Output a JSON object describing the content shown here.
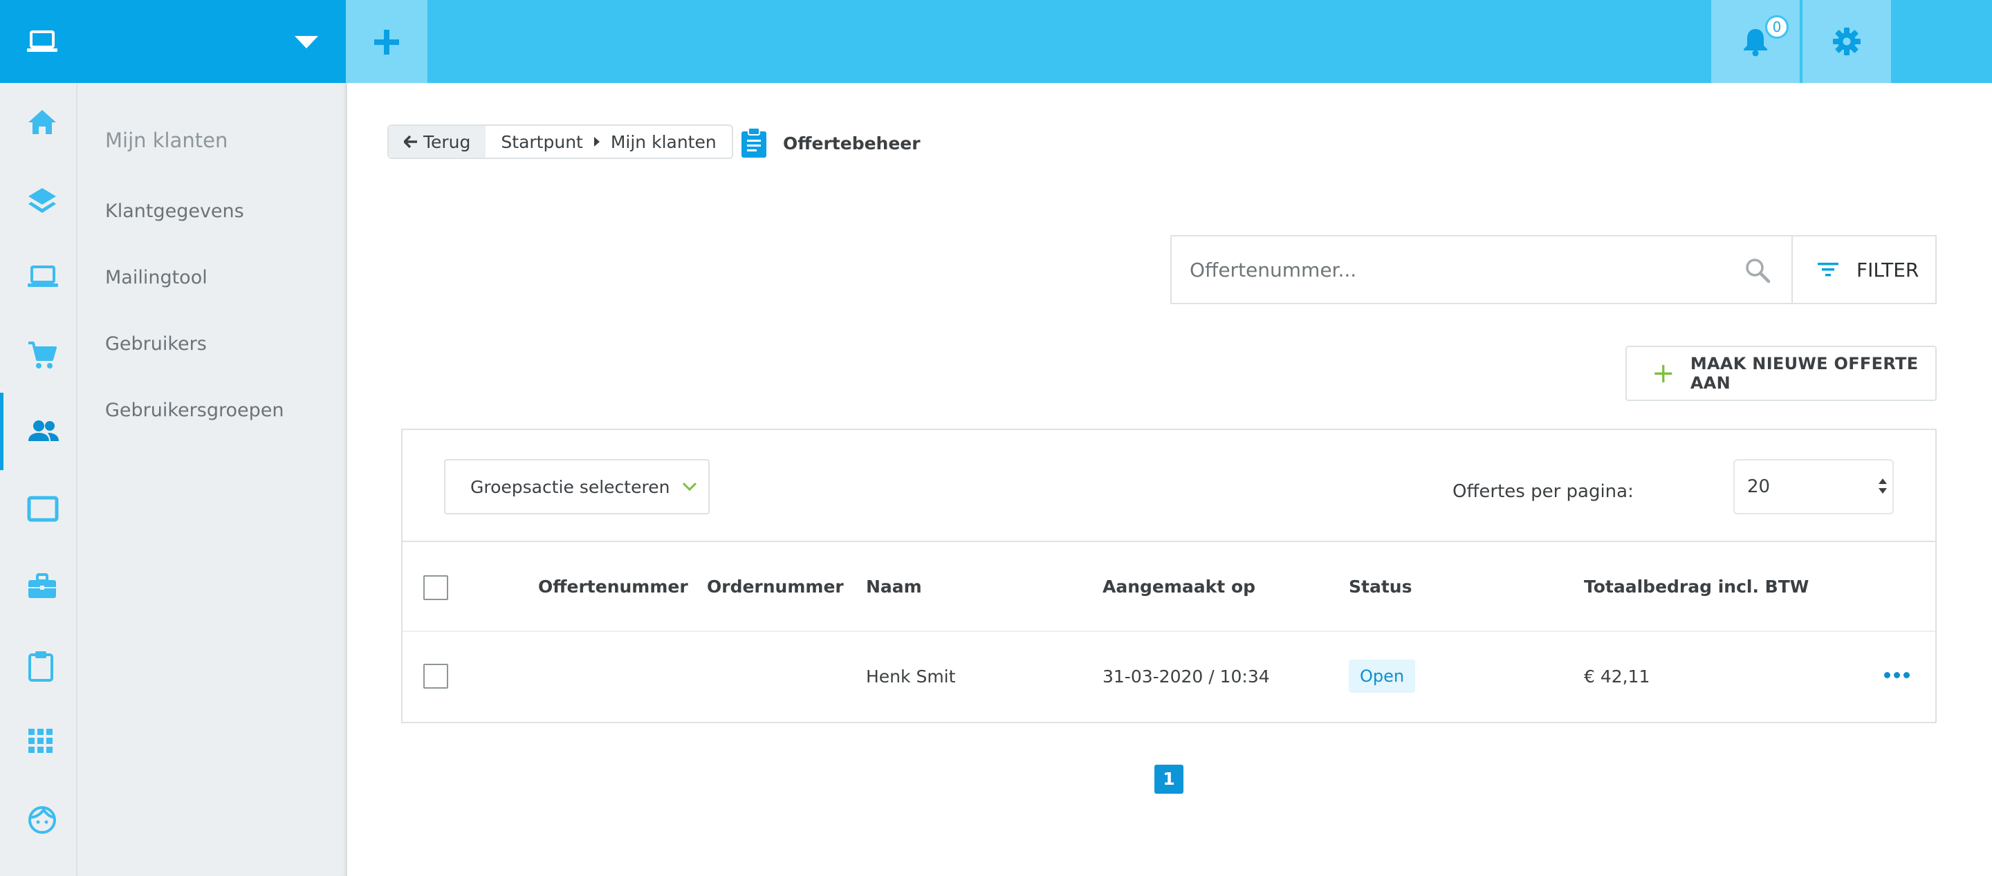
{
  "topbar": {
    "notification_count": "0",
    "colors": {
      "bar": "#3cc3f2",
      "device": "#05a5e8",
      "add": "#7dd8f7"
    }
  },
  "rail": {
    "icons": [
      "home-icon",
      "layers-icon",
      "laptop-icon",
      "cart-icon",
      "users-icon",
      "tablet-icon",
      "briefcase-icon",
      "clipboard-icon",
      "apps-grid-icon",
      "face-icon"
    ],
    "active_icon": "users-icon"
  },
  "subnav": {
    "heading": "Mijn klanten",
    "items": [
      {
        "label": "Klantgegevens"
      },
      {
        "label": "Mailingtool"
      },
      {
        "label": "Gebruikers"
      },
      {
        "label": "Gebruikersgroepen"
      }
    ]
  },
  "breadcrumb": {
    "back_label": "Terug",
    "crumbs": [
      "Startpunt",
      "Mijn klanten"
    ],
    "current": "Offertebeheer"
  },
  "search": {
    "placeholder": "Offertenummer...",
    "value": ""
  },
  "filter": {
    "label": "FILTER"
  },
  "new_quote": {
    "label": "MAAK NIEUWE OFFERTE AAN"
  },
  "table": {
    "bulk_action_placeholder": "Groepsactie selecteren",
    "per_page_label": "Offertes per pagina:",
    "per_page_value": "20",
    "columns": [
      "Offertenummer",
      "Ordernummer",
      "Naam",
      "Aangemaakt op",
      "Status",
      "Totaalbedrag incl. BTW"
    ],
    "rows": [
      {
        "offertenummer": "",
        "ordernummer": "",
        "naam": "Henk Smit",
        "aangemaakt_op": "31-03-2020 / 10:34",
        "status": "Open",
        "totaal": "€ 42,11"
      }
    ]
  },
  "pagination": {
    "current_page": "1"
  },
  "colors": {
    "accent": "#0e95d8",
    "plus_green": "#7cbf3b",
    "status_bg": "#e3f5fd"
  }
}
